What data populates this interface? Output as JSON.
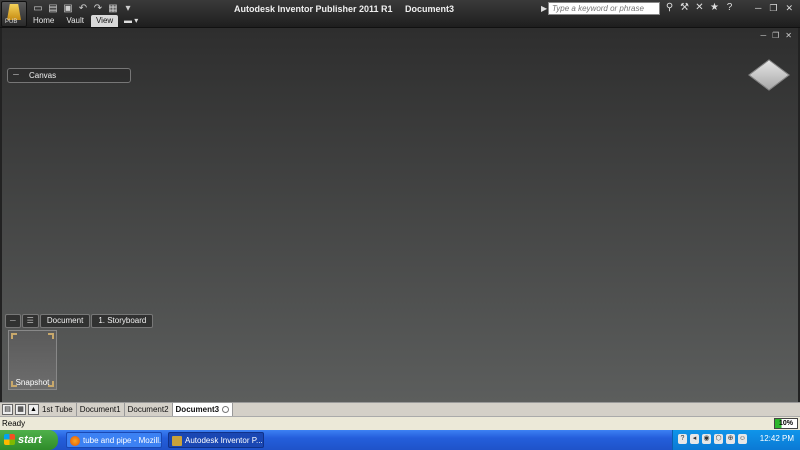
{
  "window": {
    "title": "Autodesk Inventor Publisher 2011 R1     Document3",
    "app_badge": "PUB"
  },
  "ribbon": {
    "tabs": [
      {
        "label": "Home",
        "active": false
      },
      {
        "label": "Vault",
        "active": false
      },
      {
        "label": "View",
        "active": true
      }
    ]
  },
  "search": {
    "placeholder": "Type a keyword or phrase"
  },
  "canvas": {
    "label": "Canvas"
  },
  "storyboard": {
    "breadcrumb": [
      "Document",
      "1. Storyboard"
    ],
    "snapshot_label": "Snapshot"
  },
  "document_tabs": [
    {
      "label": "1st Tube",
      "active": false
    },
    {
      "label": "Document1",
      "active": false
    },
    {
      "label": "Document2",
      "active": false
    },
    {
      "label": "Document3",
      "active": true
    }
  ],
  "status": {
    "text": "Ready",
    "zoom": "10%",
    "zoom_fraction": 0.1
  },
  "taskbar": {
    "start_label": "start",
    "tasks": [
      {
        "label": "tube and pipe - Mozill..."
      },
      {
        "label": "Autodesk Inventor P..."
      }
    ],
    "clock": "12:42 PM"
  },
  "colors": {
    "canvas_top": "#2e2e2e",
    "canvas_bottom": "#5c5e5d",
    "taskbar_blue": "#245edb",
    "start_green": "#3a9a34"
  }
}
